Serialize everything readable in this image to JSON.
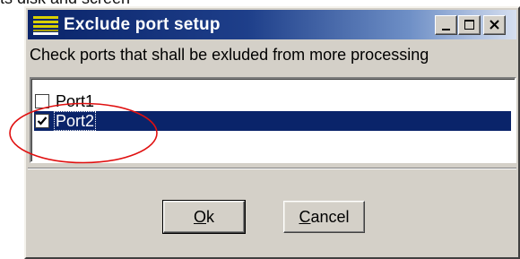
{
  "background": {
    "text": "ts disk and screen"
  },
  "window": {
    "title": "Exclude port setup",
    "prompt": "Check ports that shall be exluded from more processing",
    "ports": [
      {
        "label": "Port1",
        "checked": false,
        "selected": false
      },
      {
        "label": "Port2",
        "checked": true,
        "selected": true
      }
    ],
    "buttons": {
      "ok": {
        "mnemonic": "O",
        "rest": "k"
      },
      "cancel": {
        "mnemonic": "C",
        "rest": "ancel"
      }
    },
    "colors": {
      "title_bar": "#0a246a",
      "selection": "#0a246a",
      "face": "#d4d0c8",
      "annotation": "#e01010"
    }
  }
}
